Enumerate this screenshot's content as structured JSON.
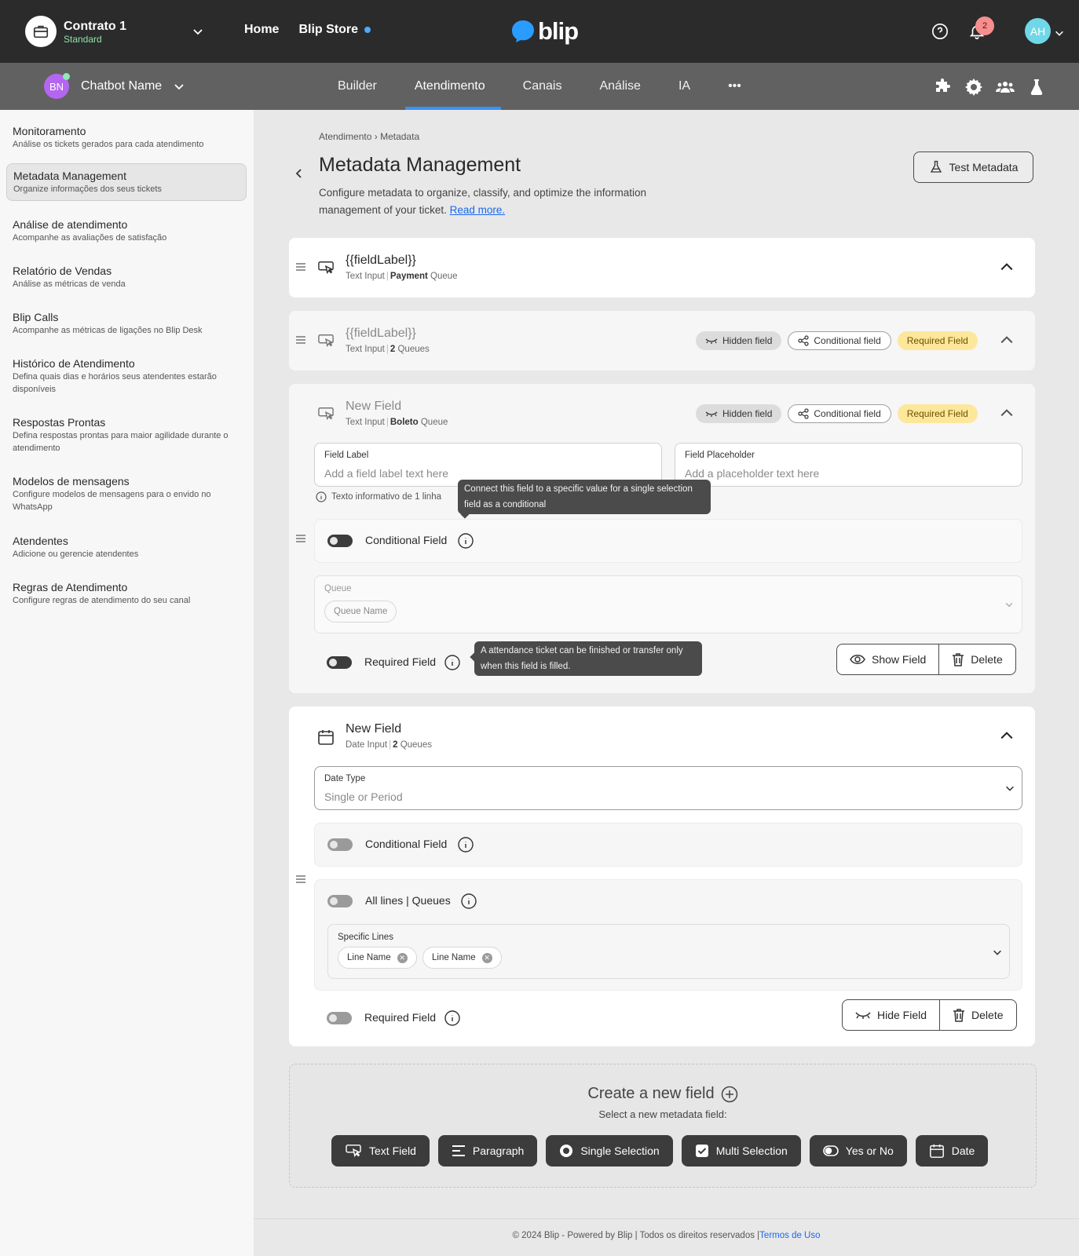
{
  "topbar": {
    "contract_title": "Contrato 1",
    "contract_plan": "Standard",
    "nav": [
      "Home",
      "Blip Store"
    ],
    "logo_text": "blip",
    "notification_count": "2",
    "user_initials": "AH"
  },
  "subbar": {
    "bot_initials": "BN",
    "bot_name": "Chatbot Name",
    "tabs": [
      "Builder",
      "Atendimento",
      "Canais",
      "Análise",
      "IA"
    ],
    "more": "•••",
    "active_tab": "Atendimento"
  },
  "sidebar": {
    "items": [
      {
        "title": "Monitoramento",
        "desc": "Análise os tickets gerados para cada atendimento"
      },
      {
        "title": "Metadata Management",
        "desc": "Organize informações dos seus tickets"
      },
      {
        "title": "Análise de atendimento",
        "desc": "Acompanhe as avaliações de satisfação"
      },
      {
        "title": "Relatório de Vendas",
        "desc": "Análise as métricas de venda"
      },
      {
        "title": "Blip Calls",
        "desc": "Acompanhe as métricas de ligações no Blip Desk"
      },
      {
        "title": "Histórico de Atendimento",
        "desc": "Defina quais dias e horários seus atendentes estarão disponíveis"
      },
      {
        "title": "Respostas Prontas",
        "desc": "Defina respostas prontas para maior agilidade durante o atendimento"
      },
      {
        "title": "Modelos de mensagens",
        "desc": "Configure modelos de mensagens para o envido no WhatsApp"
      },
      {
        "title": "Atendentes",
        "desc": "Adicione ou gerencie atendentes"
      },
      {
        "title": "Regras de Atendimento",
        "desc": "Configure regras de atendimento do seu canal"
      }
    ]
  },
  "page": {
    "breadcrumb": [
      "Atendimento",
      "Metadata"
    ],
    "title": "Metadata Management",
    "description": "Configure metadata to organize, classify, and optimize the information management of your ticket.",
    "read_more": "Read more.",
    "test_button": "Test Metadata"
  },
  "chips": {
    "hidden": "Hidden field",
    "conditional": "Conditional field",
    "required": "Required Field"
  },
  "fields": [
    {
      "label": "{{fieldLabel}}",
      "type": "Text Input",
      "queue_bold": "Payment",
      "queue_suffix": "Queue"
    },
    {
      "label": "{{fieldLabel}}",
      "type": "Text Input",
      "queue_bold": "2",
      "queue_suffix": "Queues"
    },
    {
      "label": "New Field",
      "type": "Text Input",
      "queue_bold": "Boleto",
      "queue_suffix": "Queue",
      "field_label_title": "Field Label",
      "field_label_placeholder": "Add a field label text here",
      "placeholder_title": "Field Placeholder",
      "placeholder_placeholder": "Add a placeholder text here",
      "hint": "Texto informativo de 1 linha",
      "conditional_label": "Conditional Field",
      "conditional_tooltip": "Connect this field to a specific value for a single selection field as a conditional",
      "queue_title": "Queue",
      "queue_tag": "Queue Name",
      "required_label": "Required Field",
      "required_tooltip": "A attendance ticket can be finished or transfer only when this field is filled.",
      "show_button": "Show Field",
      "delete_button": "Delete"
    },
    {
      "label": "New Field",
      "type": "Date Input",
      "queue_bold": "2",
      "queue_suffix": "Queues",
      "date_type_title": "Date Type",
      "date_type_value": "Single or Period",
      "conditional_label": "Conditional Field",
      "all_lines_label": "All lines | Queues",
      "specific_lines_title": "Specific Lines",
      "line_tags": [
        "Line Name",
        "Line Name"
      ],
      "required_label": "Required Field",
      "hide_button": "Hide Field",
      "delete_button": "Delete"
    }
  ],
  "create": {
    "title": "Create a new field",
    "subtitle": "Select a new metadata field:",
    "buttons": [
      "Text Field",
      "Paragraph",
      "Single Selection",
      "Multi Selection",
      "Yes or No",
      "Date"
    ]
  },
  "footer": {
    "text": "© 2024 Blip - Powered by Blip | Todos os direitos reservados |",
    "link": "Termos de Uso"
  },
  "colors": {
    "topbar": "#2b2b2b",
    "subbar": "#616161",
    "accent": "#3a91ff",
    "required_chip": "#fde79a",
    "link": "#1968f0"
  }
}
